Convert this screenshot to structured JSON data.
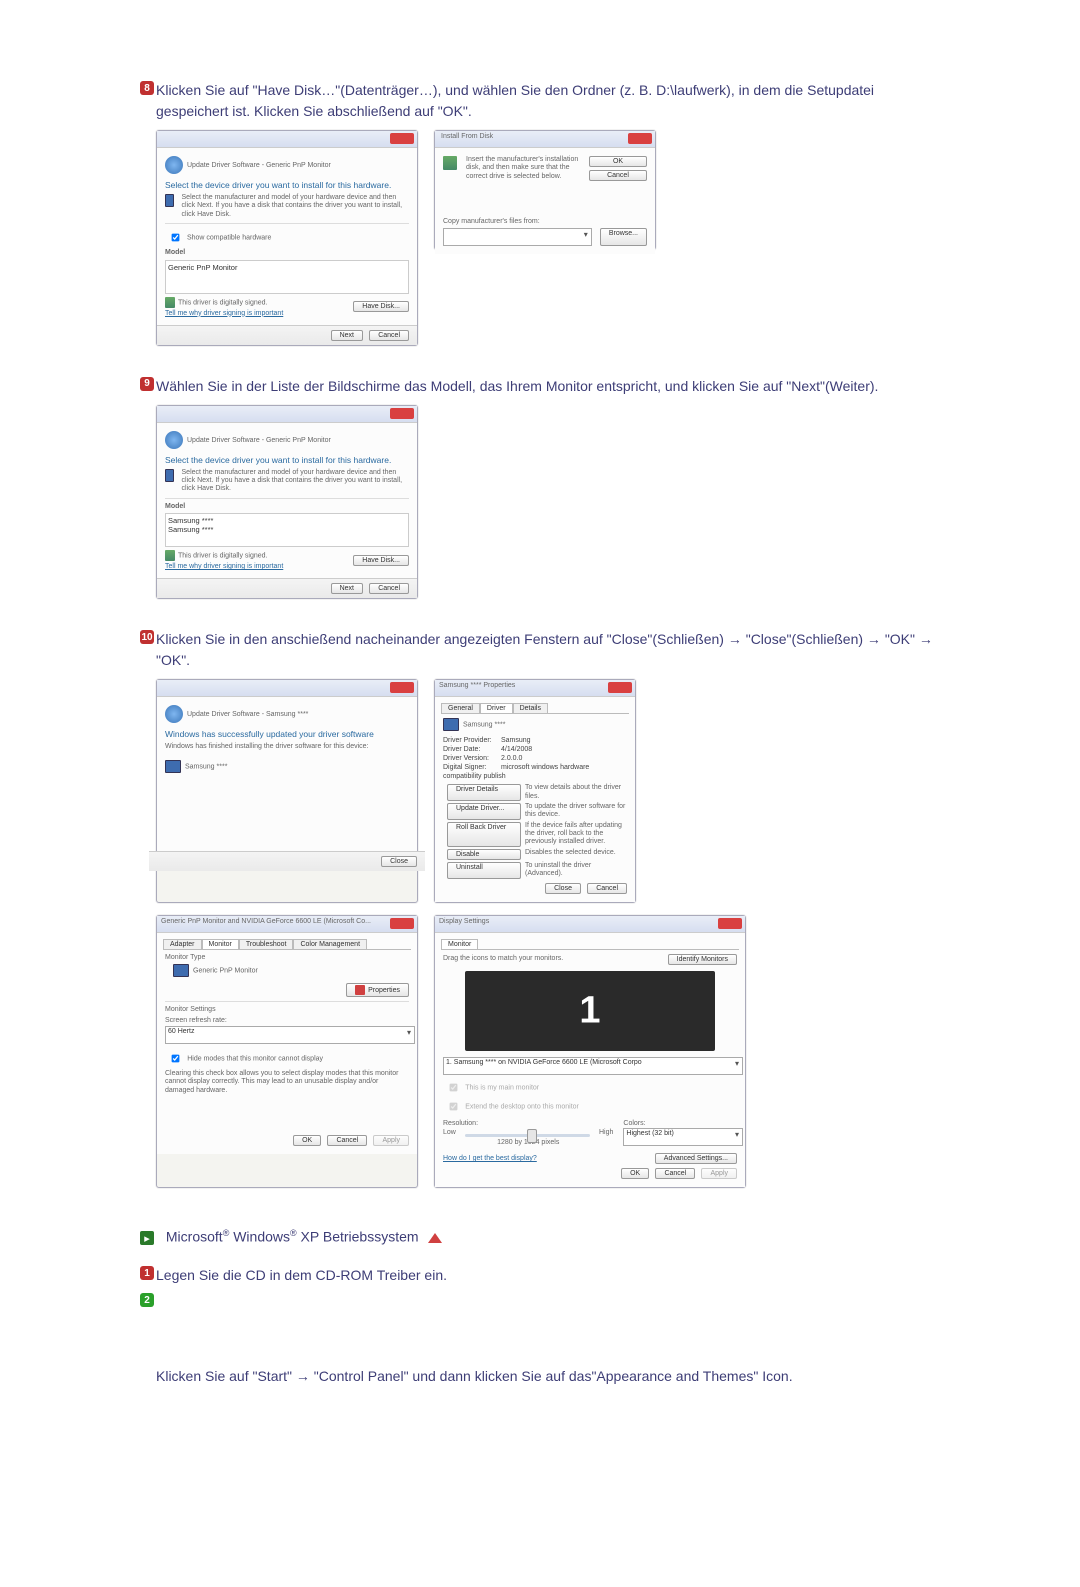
{
  "step8": {
    "num": "8",
    "text": "Klicken Sie auf \"Have Disk…\"(Datenträger…), und wählen Sie den Ordner (z. B. D:\\laufwerk), in dem die Setupdatei gespeichert ist. Klicken Sie abschließend auf \"OK\"."
  },
  "updateWindow": {
    "breadcrumb": "Update Driver Software - Generic PnP Monitor",
    "heading": "Select the device driver you want to install for this hardware.",
    "desc": "Select the manufacturer and model of your hardware device and then click Next. If you have a disk that contains the driver you want to install, click Have Disk.",
    "showCompatible": "Show compatible hardware",
    "modelLabel": "Model",
    "modelItem": "Generic PnP Monitor",
    "signed": "This driver is digitally signed.",
    "tellme": "Tell me why driver signing is important",
    "haveDisk": "Have Disk...",
    "next": "Next",
    "cancel": "Cancel"
  },
  "installFromDisk": {
    "title": "Install From Disk",
    "msg": "Insert the manufacturer's installation disk, and then make sure that the correct drive is selected below.",
    "ok": "OK",
    "cancel": "Cancel",
    "copyLabel": "Copy manufacturer's files from:",
    "browse": "Browse..."
  },
  "step9": {
    "num": "9",
    "text": "Wählen Sie in der Liste der Bildschirme das Modell, das Ihrem Monitor entspricht, und klicken Sie auf \"Next\"(Weiter)."
  },
  "updateWindow2": {
    "modelItem1": "Samsung ****",
    "modelItem2": "Samsung ****"
  },
  "step10": {
    "num": "10",
    "text": "Klicken Sie in den anschießend nacheinander angezeigten Fenstern auf \"Close\"(Schließen) → \"Close\"(Schließen) → \"OK\" → \"OK\"."
  },
  "successWindow": {
    "breadcrumb": "Update Driver Software - Samsung ****",
    "heading": "Windows has successfully updated your driver software",
    "desc": "Windows has finished installing the driver software for this device:",
    "device": "Samsung ****",
    "close": "Close"
  },
  "propsWindow": {
    "title": "Samsung **** Properties",
    "tabGeneral": "General",
    "tabDriver": "Driver",
    "tabDetails": "Details",
    "device": "Samsung ****",
    "provider": "Driver Provider:",
    "providerVal": "Samsung",
    "date": "Driver Date:",
    "dateVal": "4/14/2008",
    "version": "Driver Version:",
    "versionVal": "2.0.0.0",
    "signer": "Digital Signer:",
    "signerVal": "microsoft windows hardware compatibility publish",
    "btnDetails": "Driver Details",
    "btnDetailsDesc": "To view details about the driver files.",
    "btnUpdate": "Update Driver...",
    "btnUpdateDesc": "To update the driver software for this device.",
    "btnRoll": "Roll Back Driver",
    "btnRollDesc": "If the device fails after updating the driver, roll back to the previously installed driver.",
    "btnDisable": "Disable",
    "btnDisableDesc": "Disables the selected device.",
    "btnUninstall": "Uninstall",
    "btnUninstallDesc": "To uninstall the driver (Advanced).",
    "close": "Close",
    "cancel": "Cancel"
  },
  "monitorTab": {
    "title": "Generic PnP Monitor and NVIDIA GeForce 6600 LE (Microsoft Co...",
    "tabAdapter": "Adapter",
    "tabMonitor": "Monitor",
    "tabTrouble": "Troubleshoot",
    "tabColor": "Color Management",
    "monType": "Monitor Type",
    "monName": "Generic PnP Monitor",
    "properties": "Properties",
    "settings": "Monitor Settings",
    "refresh": "Screen refresh rate:",
    "refreshVal": "60 Hertz",
    "hideLabel": "Hide modes that this monitor cannot display",
    "hideDesc": "Clearing this check box allows you to select display modes that this monitor cannot display correctly. This may lead to an unusable display and/or damaged hardware.",
    "ok": "OK",
    "cancel": "Cancel",
    "apply": "Apply"
  },
  "displaySettings": {
    "title": "Display Settings",
    "tab": "Monitor",
    "drag": "Drag the icons to match your monitors.",
    "identify": "Identify Monitors",
    "num": "1",
    "monSel": "1. Samsung **** on NVIDIA GeForce 6600 LE (Microsoft Corpo",
    "main": "This is my main monitor",
    "extend": "Extend the desktop onto this monitor",
    "resolution": "Resolution:",
    "low": "Low",
    "high": "High",
    "resVal": "1280 by 1024 pixels",
    "colors": "Colors:",
    "colorsVal": "Highest (32 bit)",
    "best": "How do I get the best display?",
    "adv": "Advanced Settings...",
    "ok": "OK",
    "cancel": "Cancel",
    "apply": "Apply"
  },
  "osSection": {
    "prefix": "Microsoft",
    "reg": "®",
    "windows": " Windows",
    "suffix": " XP Betriebssystem"
  },
  "xpStep1": {
    "num": "1",
    "text": "Legen Sie die CD in dem CD-ROM Treiber ein."
  },
  "xpStep2": {
    "num": "2"
  },
  "bottomText": "Klicken Sie auf \"Start\" → \"Control Panel\" und dann klicken Sie auf das\"Appearance and Themes\" Icon."
}
